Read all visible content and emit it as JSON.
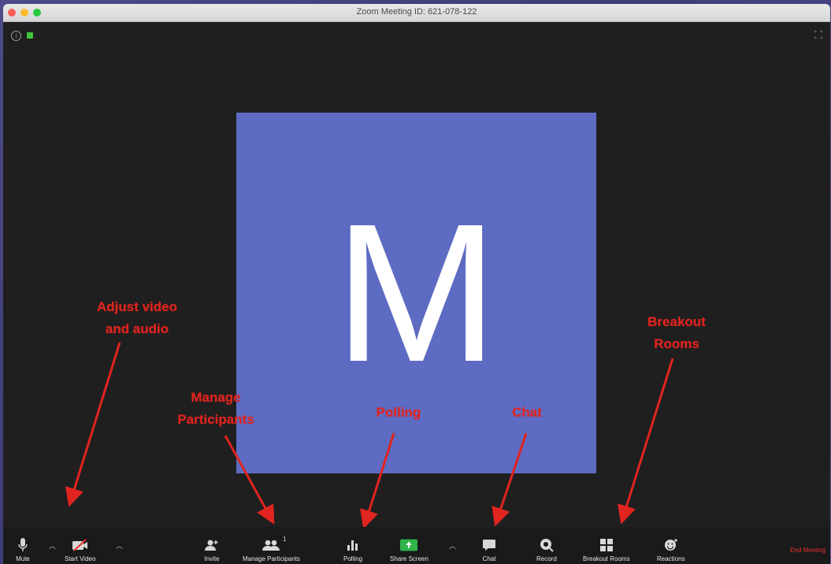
{
  "window": {
    "title": "Zoom Meeting ID: 621-078-122"
  },
  "video": {
    "avatar_letter": "M",
    "avatar_color": "#5d6bc2"
  },
  "annotations": {
    "adjust_line1": "Adjust video",
    "adjust_line2": "and audio",
    "manage_line1": "Manage",
    "manage_line2": "Participants",
    "polling": "Polling",
    "chat": "Chat",
    "breakout_line1": "Breakout",
    "breakout_line2": "Rooms",
    "color": "#e0241f"
  },
  "toolbar": {
    "mute": "Mute",
    "start_video": "Start Video",
    "invite": "Invite",
    "manage_participants": "Manage Participants",
    "participants_count": "1",
    "polling": "Polling",
    "share_screen": "Share Screen",
    "chat": "Chat",
    "record": "Record",
    "breakout_rooms": "Breakout Rooms",
    "reactions": "Reactions",
    "end_meeting": "End Meeting"
  },
  "colors": {
    "share_green": "#2fb34a",
    "end_red": "#e8322b",
    "toolbar_bg": "#1a1a1a"
  }
}
